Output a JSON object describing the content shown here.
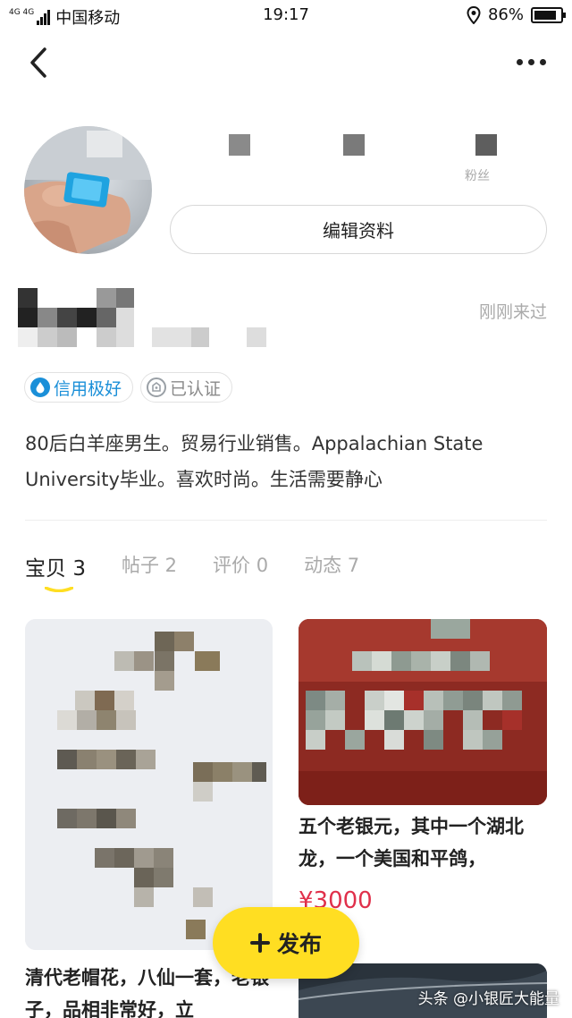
{
  "status_bar": {
    "network_tag": "4G 4G",
    "carrier": "中国移动",
    "time": "19:17",
    "battery_percent": "86%",
    "battery_level": 0.86
  },
  "nav": {
    "back_icon": "chevron-left-icon",
    "more_icon": "more-dots-icon"
  },
  "profile": {
    "stat_labels": [
      "",
      "",
      "粉丝"
    ],
    "edit_button": "编辑资料",
    "last_seen": "刚刚来过",
    "badges": [
      {
        "label": "信用极好",
        "icon": "water-drop-icon",
        "color": "#1a8fd8"
      },
      {
        "label": "已认证",
        "icon": "verified-shield-icon",
        "color": "#8a8a8a"
      }
    ],
    "bio": "80后白羊座男生。贸易行业销售。Appalachian State University毕业。喜欢时尚。生活需要静心"
  },
  "tabs": [
    {
      "label": "宝贝",
      "count": "3",
      "active": true
    },
    {
      "label": "帖子",
      "count": "2",
      "active": false
    },
    {
      "label": "评价",
      "count": "0",
      "active": false
    },
    {
      "label": "动态",
      "count": "7",
      "active": false
    }
  ],
  "items": [
    {
      "title": "清代老帽花，八仙一套，老银子，品相非常好，立",
      "price": ""
    },
    {
      "title": "五个老银元，其中一个湖北龙，一个美国和平鸽，",
      "price": "¥3000"
    }
  ],
  "fab": {
    "label": "发布",
    "icon": "plus-icon"
  },
  "watermark": "头条 @小银匠大能量",
  "colors": {
    "accent": "#ffde22",
    "price": "#e0304b",
    "credit": "#1a8fd8"
  }
}
